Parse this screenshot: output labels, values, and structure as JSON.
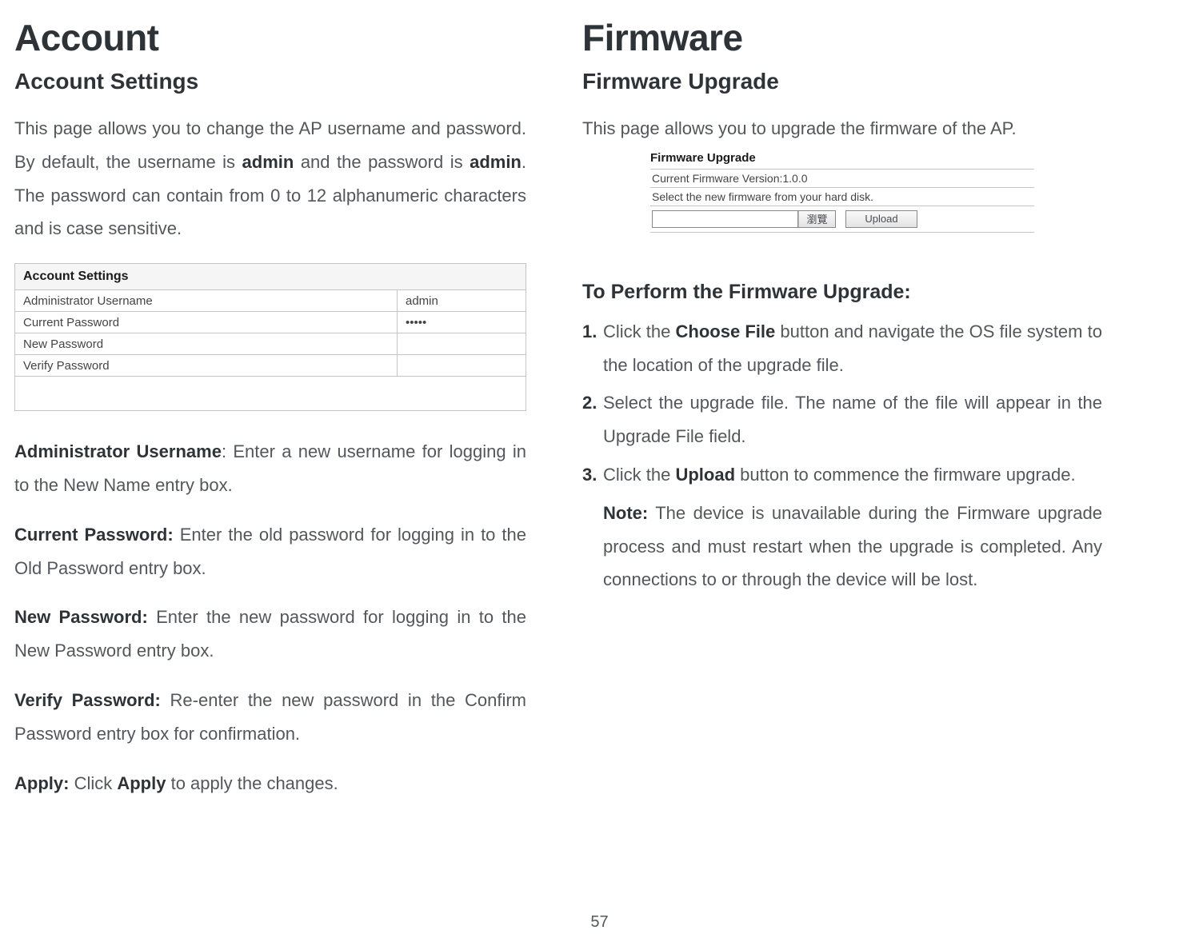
{
  "left": {
    "heading": "Account",
    "subheading": "Account Settings",
    "intro_pre": "This page allows you to change the AP username and password. By default, the username is ",
    "intro_b1": "admin",
    "intro_mid": " and the password is ",
    "intro_b2": "admin",
    "intro_post": ". The password can contain from 0 to 12 alphanumeric characters and is case sensitive.",
    "table": {
      "title": "Account Settings",
      "rows": [
        {
          "label": "Administrator Username",
          "value": "admin"
        },
        {
          "label": "Current Password",
          "value": "•••••"
        },
        {
          "label": "New Password",
          "value": ""
        },
        {
          "label": "Verify Password",
          "value": ""
        }
      ]
    },
    "fields": {
      "admin_label": "Administrator Username",
      "admin_text": ": Enter a new username for logging in to the New Name entry box.",
      "current_label": "Current Password:",
      "current_text": " Enter the old password for logging in to the Old Password entry box.",
      "new_label": "New Password:",
      "new_text": " Enter the new password for logging in to the New Password entry box.",
      "verify_label": "Verify Password:",
      "verify_text": " Re-enter the new password in the Confirm Password entry box for confirmation.",
      "apply_label": "Apply:",
      "apply_pre": " Click ",
      "apply_b": "Apply",
      "apply_post": " to apply the changes."
    }
  },
  "right": {
    "heading": "Firmware",
    "subheading": "Firmware Upgrade",
    "intro": "This page allows you to upgrade the firmware of the AP.",
    "screenshot": {
      "title": "Firmware Upgrade",
      "version": "Current Firmware Version:1.0.0",
      "select": "Select the new firmware from your hard disk.",
      "browse": "瀏覽",
      "upload": "Upload"
    },
    "perform_heading": "To Perform the Firmware Upgrade:",
    "steps": [
      {
        "n": "1.",
        "pre": "Click the ",
        "b": "Choose File",
        "post": " button and navigate the OS file system to the location of the upgrade file."
      },
      {
        "n": "2.",
        "pre": "Select the upgrade file. The name of the file will appear in the Upgrade File field.",
        "b": "",
        "post": ""
      },
      {
        "n": "3.",
        "pre": "Click the ",
        "b": "Upload",
        "post": " button to commence the firmware upgrade."
      }
    ],
    "note_label": "Note:",
    "note_text": " The device is unavailable during the Firmware upgrade process and must restart when the upgrade is completed. Any connections to or through the device will be lost."
  },
  "page_number": "57"
}
